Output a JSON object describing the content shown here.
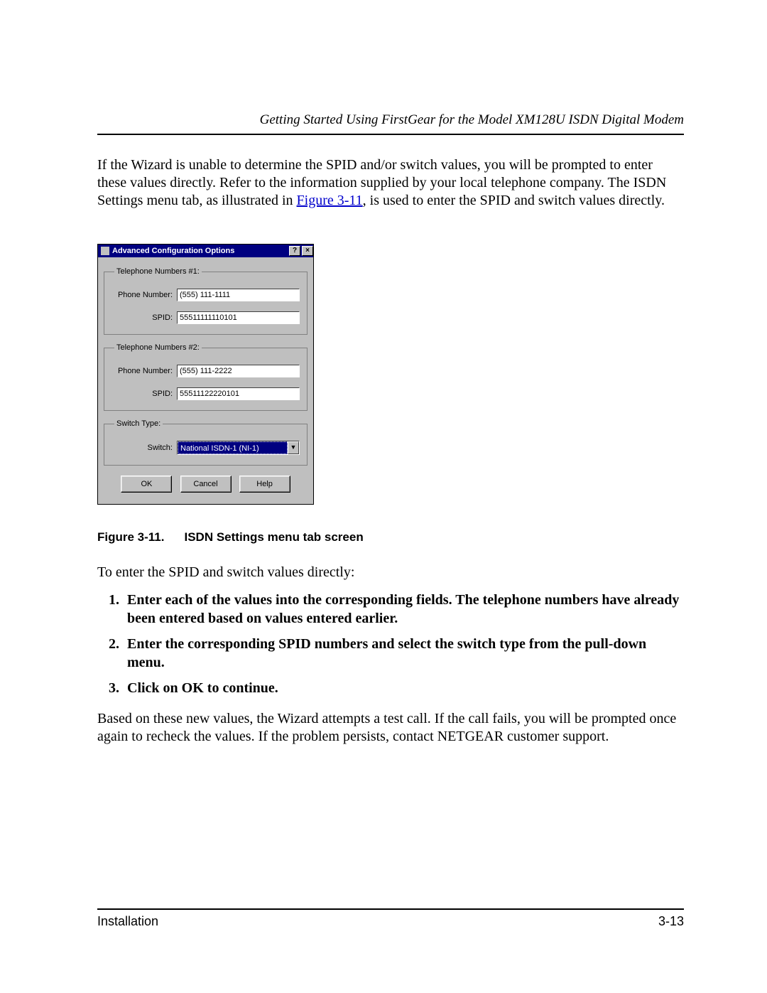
{
  "header": {
    "title": "Getting Started Using FirstGear for the Model XM128U ISDN Digital Modem"
  },
  "intro_para": {
    "before_link": "If the Wizard is unable to determine the SPID and/or switch values, you will be prompted to enter these values directly. Refer to the information supplied by your local telephone company. The ISDN Settings menu tab, as illustrated in ",
    "link_text": "Figure 3-11",
    "after_link": ", is used to enter the SPID and switch values directly."
  },
  "dialog": {
    "title": "Advanced Configuration Options",
    "help_btn": "?",
    "close_btn": "×",
    "group1": {
      "legend": "Telephone Numbers #1:",
      "phone_label": "Phone Number:",
      "phone_value": "(555) 111-1111",
      "spid_label": "SPID:",
      "spid_value": "55511111110101"
    },
    "group2": {
      "legend": "Telephone Numbers #2:",
      "phone_label": "Phone Number:",
      "phone_value": "(555) 111-2222",
      "spid_label": "SPID:",
      "spid_value": "55511122220101"
    },
    "group3": {
      "legend": "Switch Type:",
      "switch_label": "Switch:",
      "switch_value": "National ISDN-1 (NI-1)",
      "dropdown_glyph": "▼"
    },
    "buttons": {
      "ok": "OK",
      "cancel": "Cancel",
      "help": "Help"
    }
  },
  "caption": {
    "num": "Figure 3-11.",
    "text": "ISDN Settings menu tab screen"
  },
  "steps_intro": "To enter the SPID and switch values directly:",
  "steps": [
    "Enter each of the values into the corresponding fields. The telephone numbers have already been entered based on values entered earlier.",
    "Enter the corresponding SPID numbers and select the switch type from the pull-down menu.",
    "Click on OK to continue."
  ],
  "closing_para": "Based on these new values, the Wizard attempts a test call. If the call fails, you will be prompted once again to recheck the values. If the problem persists, contact NETGEAR customer support.",
  "footer": {
    "left": "Installation",
    "right": "3-13"
  }
}
